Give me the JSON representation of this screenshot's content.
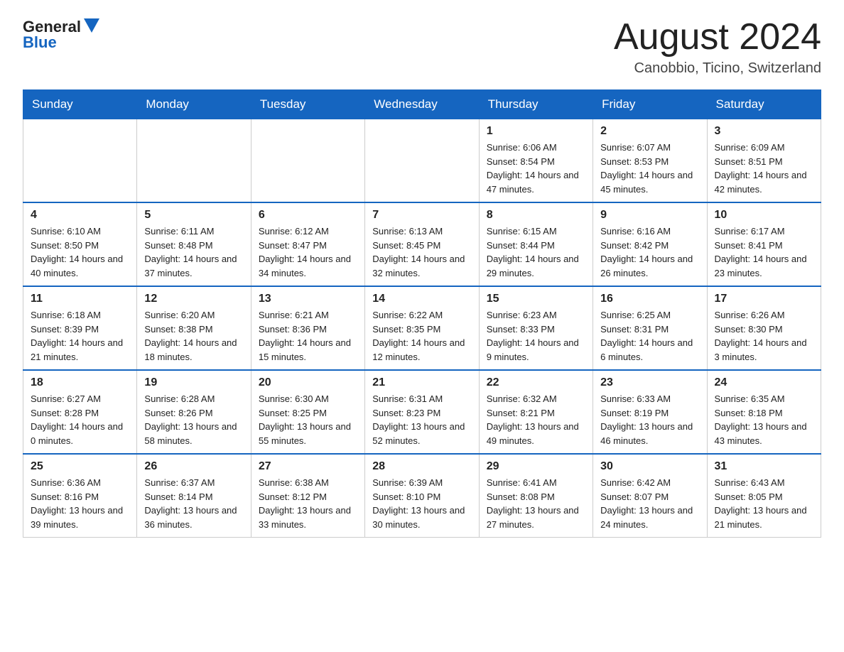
{
  "header": {
    "logo": {
      "general": "General",
      "blue": "Blue"
    },
    "title": "August 2024",
    "location": "Canobbio, Ticino, Switzerland"
  },
  "calendar": {
    "days_of_week": [
      "Sunday",
      "Monday",
      "Tuesday",
      "Wednesday",
      "Thursday",
      "Friday",
      "Saturday"
    ],
    "weeks": [
      [
        {
          "day": "",
          "info": ""
        },
        {
          "day": "",
          "info": ""
        },
        {
          "day": "",
          "info": ""
        },
        {
          "day": "",
          "info": ""
        },
        {
          "day": "1",
          "info": "Sunrise: 6:06 AM\nSunset: 8:54 PM\nDaylight: 14 hours and 47 minutes."
        },
        {
          "day": "2",
          "info": "Sunrise: 6:07 AM\nSunset: 8:53 PM\nDaylight: 14 hours and 45 minutes."
        },
        {
          "day": "3",
          "info": "Sunrise: 6:09 AM\nSunset: 8:51 PM\nDaylight: 14 hours and 42 minutes."
        }
      ],
      [
        {
          "day": "4",
          "info": "Sunrise: 6:10 AM\nSunset: 8:50 PM\nDaylight: 14 hours and 40 minutes."
        },
        {
          "day": "5",
          "info": "Sunrise: 6:11 AM\nSunset: 8:48 PM\nDaylight: 14 hours and 37 minutes."
        },
        {
          "day": "6",
          "info": "Sunrise: 6:12 AM\nSunset: 8:47 PM\nDaylight: 14 hours and 34 minutes."
        },
        {
          "day": "7",
          "info": "Sunrise: 6:13 AM\nSunset: 8:45 PM\nDaylight: 14 hours and 32 minutes."
        },
        {
          "day": "8",
          "info": "Sunrise: 6:15 AM\nSunset: 8:44 PM\nDaylight: 14 hours and 29 minutes."
        },
        {
          "day": "9",
          "info": "Sunrise: 6:16 AM\nSunset: 8:42 PM\nDaylight: 14 hours and 26 minutes."
        },
        {
          "day": "10",
          "info": "Sunrise: 6:17 AM\nSunset: 8:41 PM\nDaylight: 14 hours and 23 minutes."
        }
      ],
      [
        {
          "day": "11",
          "info": "Sunrise: 6:18 AM\nSunset: 8:39 PM\nDaylight: 14 hours and 21 minutes."
        },
        {
          "day": "12",
          "info": "Sunrise: 6:20 AM\nSunset: 8:38 PM\nDaylight: 14 hours and 18 minutes."
        },
        {
          "day": "13",
          "info": "Sunrise: 6:21 AM\nSunset: 8:36 PM\nDaylight: 14 hours and 15 minutes."
        },
        {
          "day": "14",
          "info": "Sunrise: 6:22 AM\nSunset: 8:35 PM\nDaylight: 14 hours and 12 minutes."
        },
        {
          "day": "15",
          "info": "Sunrise: 6:23 AM\nSunset: 8:33 PM\nDaylight: 14 hours and 9 minutes."
        },
        {
          "day": "16",
          "info": "Sunrise: 6:25 AM\nSunset: 8:31 PM\nDaylight: 14 hours and 6 minutes."
        },
        {
          "day": "17",
          "info": "Sunrise: 6:26 AM\nSunset: 8:30 PM\nDaylight: 14 hours and 3 minutes."
        }
      ],
      [
        {
          "day": "18",
          "info": "Sunrise: 6:27 AM\nSunset: 8:28 PM\nDaylight: 14 hours and 0 minutes."
        },
        {
          "day": "19",
          "info": "Sunrise: 6:28 AM\nSunset: 8:26 PM\nDaylight: 13 hours and 58 minutes."
        },
        {
          "day": "20",
          "info": "Sunrise: 6:30 AM\nSunset: 8:25 PM\nDaylight: 13 hours and 55 minutes."
        },
        {
          "day": "21",
          "info": "Sunrise: 6:31 AM\nSunset: 8:23 PM\nDaylight: 13 hours and 52 minutes."
        },
        {
          "day": "22",
          "info": "Sunrise: 6:32 AM\nSunset: 8:21 PM\nDaylight: 13 hours and 49 minutes."
        },
        {
          "day": "23",
          "info": "Sunrise: 6:33 AM\nSunset: 8:19 PM\nDaylight: 13 hours and 46 minutes."
        },
        {
          "day": "24",
          "info": "Sunrise: 6:35 AM\nSunset: 8:18 PM\nDaylight: 13 hours and 43 minutes."
        }
      ],
      [
        {
          "day": "25",
          "info": "Sunrise: 6:36 AM\nSunset: 8:16 PM\nDaylight: 13 hours and 39 minutes."
        },
        {
          "day": "26",
          "info": "Sunrise: 6:37 AM\nSunset: 8:14 PM\nDaylight: 13 hours and 36 minutes."
        },
        {
          "day": "27",
          "info": "Sunrise: 6:38 AM\nSunset: 8:12 PM\nDaylight: 13 hours and 33 minutes."
        },
        {
          "day": "28",
          "info": "Sunrise: 6:39 AM\nSunset: 8:10 PM\nDaylight: 13 hours and 30 minutes."
        },
        {
          "day": "29",
          "info": "Sunrise: 6:41 AM\nSunset: 8:08 PM\nDaylight: 13 hours and 27 minutes."
        },
        {
          "day": "30",
          "info": "Sunrise: 6:42 AM\nSunset: 8:07 PM\nDaylight: 13 hours and 24 minutes."
        },
        {
          "day": "31",
          "info": "Sunrise: 6:43 AM\nSunset: 8:05 PM\nDaylight: 13 hours and 21 minutes."
        }
      ]
    ]
  }
}
